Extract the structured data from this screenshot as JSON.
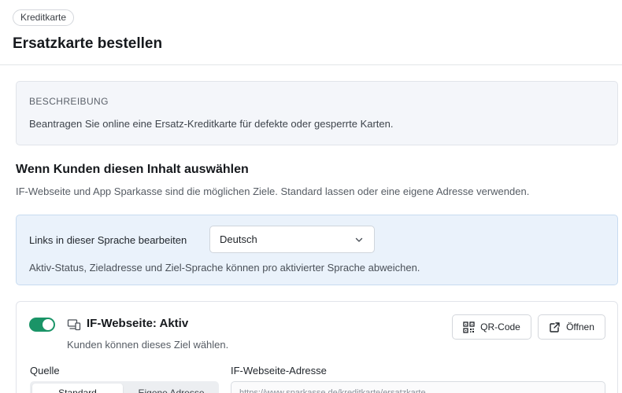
{
  "header": {
    "chip": "Kreditkarte",
    "title": "Ersatzkarte bestellen"
  },
  "description": {
    "label": "BESCHREIBUNG",
    "text": "Beantragen Sie online eine Ersatz-Kreditkarte für defekte oder gesperrte Karten."
  },
  "targets": {
    "title": "Wenn Kunden diesen Inhalt auswählen",
    "subtitle": "IF-Webseite und App Sparkasse sind die möglichen Ziele. Standard lassen oder eine eigene Adresse verwenden."
  },
  "language": {
    "label": "Links in dieser Sprache bearbeiten",
    "selected": "Deutsch",
    "note": "Aktiv-Status, Zieladresse und Ziel-Sprache können pro aktivierter Sprache abweichen."
  },
  "target_card": {
    "toggle_on": true,
    "title": "IF-Webseite: Aktiv",
    "subtitle": "Kunden können dieses Ziel wählen.",
    "qr_button": "QR-Code",
    "open_button": "Öffnen",
    "source_label": "Quelle",
    "source_options": [
      "Standard",
      "Eigene Adresse"
    ],
    "source_selected": "Standard",
    "address_label": "IF-Webseite-Adresse",
    "address_value": "https://www.sparkasse.de/kreditkarte/ersatzkarte"
  },
  "colors": {
    "accent_green": "#1a9467",
    "info_blue_bg": "#eaf2fb"
  }
}
